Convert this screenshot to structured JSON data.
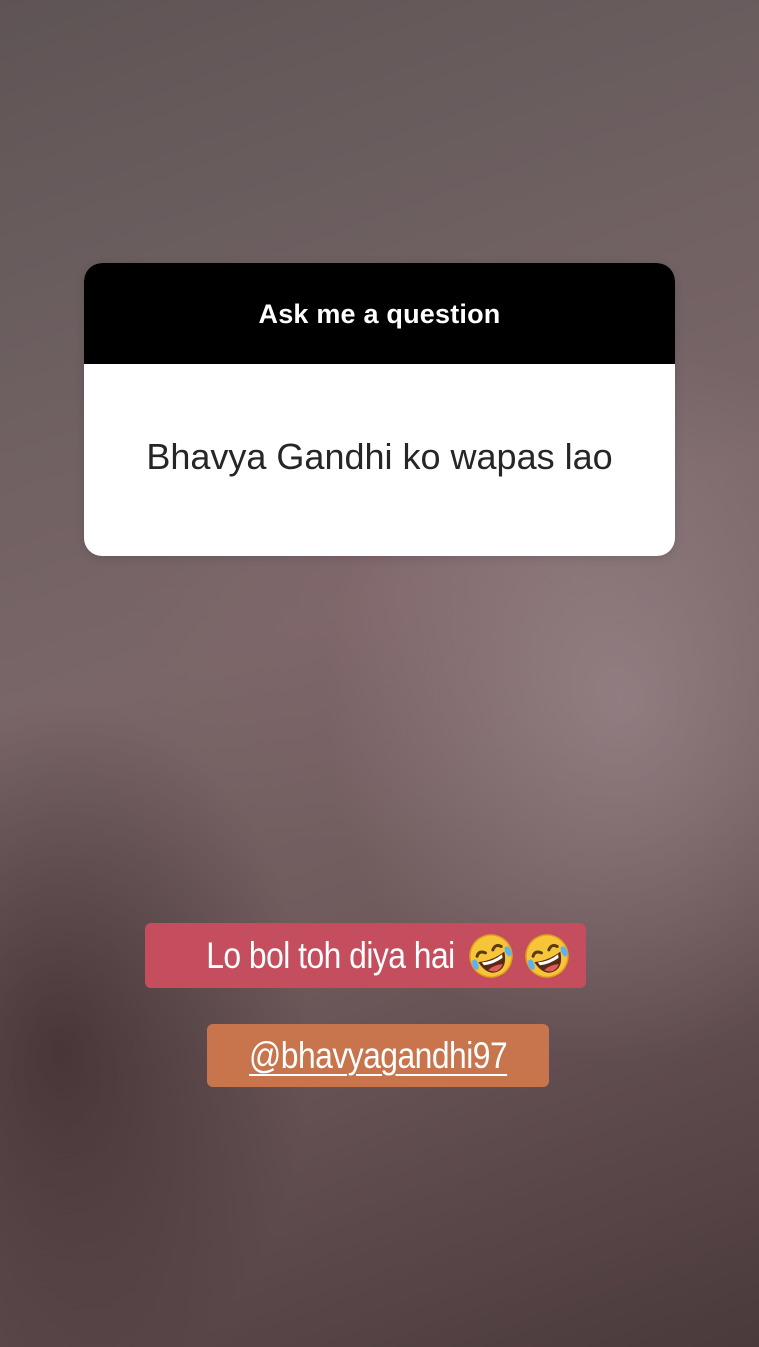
{
  "question_sticker": {
    "prompt": "Ask me a question",
    "answer": "Bhavya Gandhi ko wapas lao"
  },
  "caption": {
    "text": "Lo bol toh diya hai",
    "emojis": [
      "rolling-on-floor-laughing-icon",
      "rolling-on-floor-laughing-icon"
    ],
    "background_color": "#c44e5d"
  },
  "mention": {
    "handle": "@bhavyagandhi97",
    "background_color": "#c8744d"
  }
}
